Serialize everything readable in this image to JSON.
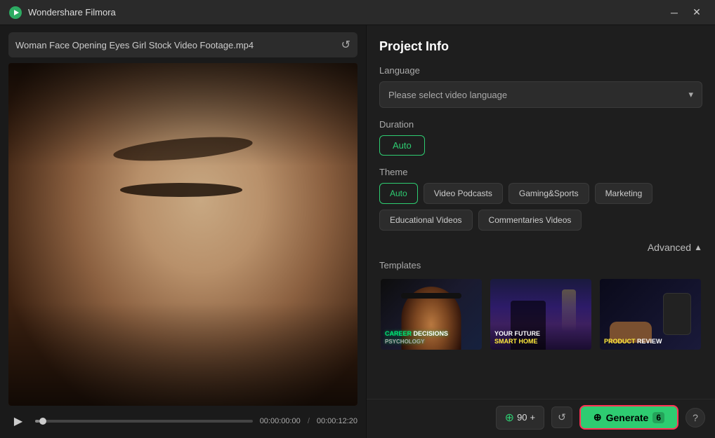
{
  "app": {
    "title": "Wondershare Filmora",
    "logo_symbol": "🎬"
  },
  "titlebar": {
    "title": "Wondershare Filmora",
    "minimize_label": "─",
    "close_label": "✕"
  },
  "filepath": {
    "text": "Woman Face Opening Eyes Girl  Stock Video Footage.mp4",
    "refresh_icon": "↺"
  },
  "controls": {
    "play_icon": "▶",
    "time_current": "00:00:00:00",
    "time_separator": "/",
    "time_total": "00:00:12:20"
  },
  "right": {
    "title": "Project Info",
    "language": {
      "label": "Language",
      "placeholder": "Please select video language",
      "chevron": "▾"
    },
    "duration": {
      "label": "Duration",
      "auto_label": "Auto"
    },
    "theme": {
      "label": "Theme",
      "buttons": [
        "Auto",
        "Video Podcasts",
        "Gaming&Sports",
        "Marketing",
        "Educational Videos",
        "Commentaries Videos"
      ]
    },
    "advanced": {
      "label": "Advanced",
      "arrow": "▲"
    },
    "templates": {
      "label": "Templates",
      "items": [
        {
          "id": "tpl1",
          "title_line1": "CAREER",
          "title_line2": "DECISIONS",
          "title_line3": "PSYCHOLOGY",
          "accent_color": "#00e676"
        },
        {
          "id": "tpl2",
          "title_line1": "YOUR FUTURE",
          "title_line2": "SMART HOME",
          "accent_color": "#ffeb3b"
        },
        {
          "id": "tpl3",
          "title_line1": "PRODUCT",
          "title_line2": "REVIEW",
          "accent_color": "#ffeb3b"
        }
      ]
    }
  },
  "bottom": {
    "credits_icon": "⊕",
    "credits_value": "90",
    "credits_suffix": "+",
    "refresh_icon": "↺",
    "generate_label": "Generate",
    "generate_icon": "⊕",
    "generate_count": "6",
    "help_icon": "?"
  }
}
